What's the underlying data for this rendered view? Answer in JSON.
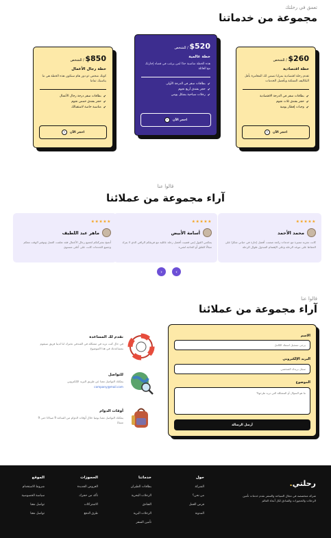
{
  "services": {
    "eyebrow": "تعمق في رحلتك",
    "title": "مجموعة من خدماتنا",
    "plans": [
      {
        "price": "$260",
        "per": " / للشخص",
        "name": "خطة اقتصادية",
        "desc": "تقدم رحلة اقتصادية بمزايا تضمن لك المغامرة بأقل التكاليف الممكنة وبأفضل الخدمات",
        "features": [
          "بطاقات سفر في الدرجة الاقتصادية",
          "حجز بفندق ثلاث نجوم",
          "وجبات إفطار يومية"
        ],
        "button": "احجز الآن"
      },
      {
        "price": "$520",
        "per": " / للشخص",
        "name": "خطة عالمية",
        "desc": "هذه الخطة مناسبة جدًا لمن يرغب في قضاء إجازتك مع العائلة",
        "features": [
          "بطاقات سفر في الدرجة الأولى",
          "حجز بفندق أربع نجوم",
          "رحلات سياحية بشكل يومي"
        ],
        "button": "احجز الآن"
      },
      {
        "price": "$850",
        "per": " / للشخص",
        "name": "خطة رجال الأعمال",
        "desc": "كونك شخص ذو دور هام سنكون هذه الخطة هي ما يناسبك تماما",
        "features": [
          "بطاقات سفر درجة رجال الأعمال",
          "حجز بفندق خمس نجوم",
          "مناسبة خاصة لاستقبالك"
        ],
        "button": "احجز الآن"
      }
    ]
  },
  "testimonials": {
    "eyebrow": "قالوا عنا",
    "title": "آراء مجموعة من عملائنا",
    "stars": "★★★★★",
    "items": [
      {
        "name": "محمد الأحمد",
        "text": "كانت تجربة مميزة مع خدمات رائعة ضمنت أفضل إجازة في حياتي شكرًا على الحفاظ على موعد الرحلة وعلى الإهتمام المبذول طوال الرحلة"
      },
      {
        "name": "أسامة الأبيض",
        "text": "يمكنني القول إنني قضيت أفضل رحلة عائلية مع فريقكم الراقي الذي لا يترك مجالًا للقلق أو الحاجة لشيء"
      },
      {
        "name": "ماهر عبد اللطيف",
        "text": "أنصح بشركتكم لجميع رجال الأعمال فقد تعلمت العمل وتوفير الوقت معكم وجميع الخدمات كانت على أعلى مستوى"
      }
    ],
    "prev": "‹",
    "next": "›"
  },
  "contact": {
    "eyebrow": "قالوا عنا",
    "title": "آراء مجموعة من عملائنا",
    "info": [
      {
        "title": "نقدم لك المساعدة",
        "text": "في حال كنت تريد في مشكلة في الفندقي تخبرك لنا لدينا فريق سيقوم بمساعدتك في هذا الموضوع"
      },
      {
        "title": "للتواصل",
        "text": "يمكنك التواصل معنا عن طريق البريد الإلكتروني",
        "email": "company@mail.com"
      },
      {
        "title": "أوقات الدوام",
        "text": "يمكنك التواصل معنا يوميا خلال أوقات الدوام من الساعة 9 صباحًا حتى 9 مساءً"
      }
    ],
    "form": {
      "name_label": "الاسم",
      "name_placeholder": "يرجى تسجيل اسمك الكامل",
      "email_label": "البريد الإلكتروني",
      "email_placeholder": "سجل بريدك الشخصي",
      "subject_label": "الموضوع",
      "subject_placeholder": "ما هو السؤال أو المشكلة التي تريد طرحها؟",
      "submit": "أرسل الرسالة"
    }
  },
  "footer": {
    "logo": "رحلتي",
    "logo_dot": ".",
    "description": "شركة متخصصة في مجال السياحة والسفر نقدم خدمات تأمين الرحلات والحجوزات والفنادق لكل أنحاء العالم",
    "columns": [
      {
        "title": "حول",
        "links": [
          "الشركة",
          "من نحن؟",
          "فرص العمل",
          "المدونة"
        ]
      },
      {
        "title": "خدماتنا",
        "links": [
          "بطاقات الطيران",
          "الرحلات البحرية",
          "الفنادق",
          "الرحلات البرية",
          "تأمين السفر"
        ]
      },
      {
        "title": "الحجوزات",
        "links": [
          "العروض الجديدة",
          "تأكد من حجزك",
          "الاشتراكات",
          "طرق الدفع"
        ]
      },
      {
        "title": "الموقع",
        "links": [
          "شروط الاستخدام",
          "سياسة الخصوصية",
          "تواصل معنا",
          "تواصل معنا"
        ]
      }
    ]
  }
}
